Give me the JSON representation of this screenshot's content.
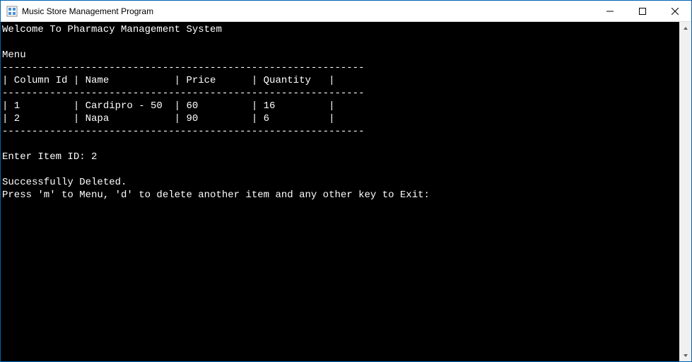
{
  "window": {
    "title": "Music Store Management Program"
  },
  "console": {
    "welcome": "Welcome To Pharmacy Management System",
    "menu_label": "Menu",
    "separator": "-------------------------------------------------------------",
    "header": "| Column Id | Name           | Price      | Quantity   |",
    "rows": [
      "| 1         | Cardipro - 50  | 60         | 16         |",
      "| 2         | Napa           | 90         | 6          |"
    ],
    "prompt_enter_label": "Enter Item ID: ",
    "prompt_enter_value": "2",
    "success_msg": "Successfully Deleted.",
    "instructions": "Press 'm' to Menu, 'd' to delete another item and any other key to Exit: "
  },
  "table": {
    "columns": [
      "Column Id",
      "Name",
      "Price",
      "Quantity"
    ],
    "data": [
      {
        "column_id": "1",
        "name": "Cardipro - 50",
        "price": "60",
        "quantity": "16"
      },
      {
        "column_id": "2",
        "name": "Napa",
        "price": "90",
        "quantity": "6"
      }
    ]
  }
}
